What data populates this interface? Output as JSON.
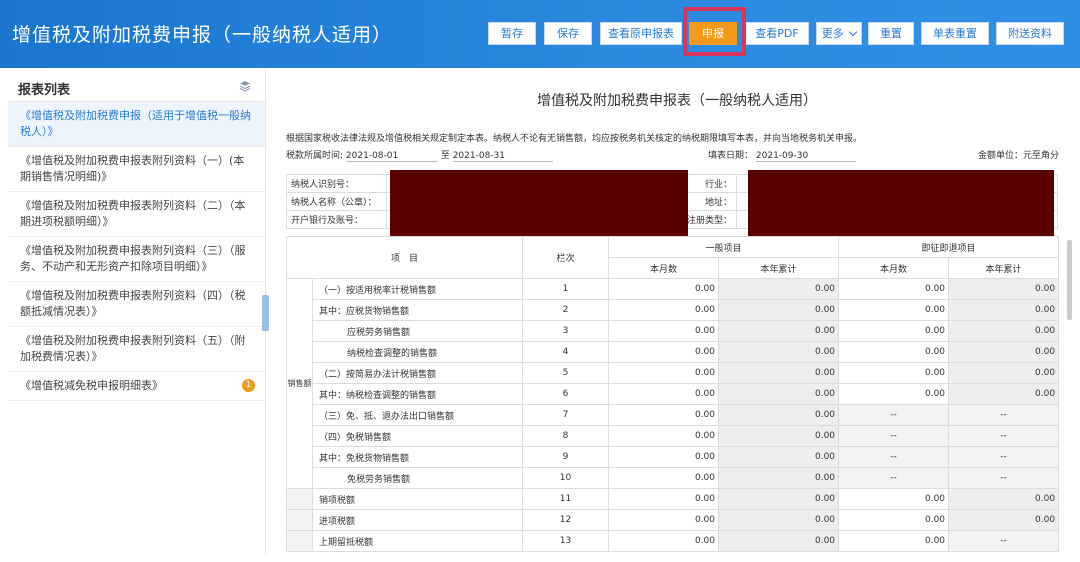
{
  "header": {
    "title": "增值税及附加税费申报（一般纳税人适用）",
    "toolbar": [
      "暂存",
      "保存",
      "查看原申报表",
      "申报",
      "查看PDF",
      "更多",
      "重置",
      "单表重置",
      "附送资料"
    ]
  },
  "sidebar": {
    "title": "报表列表",
    "items": [
      {
        "label": "《增值税及附加税费申报（适用于增值税一般纳税人）》",
        "active": true
      },
      {
        "label": "《增值税及附加税费申报表附列资料（一）(本期销售情况明细)》"
      },
      {
        "label": "《增值税及附加税费申报表附列资料（二）（本期进项税额明细）》"
      },
      {
        "label": "《增值税及附加税费申报表附列资料（三）（服务、不动产和无形资产扣除项目明细）》"
      },
      {
        "label": "《增值税及附加税费申报表附列资料（四）（税额抵减情况表）》"
      },
      {
        "label": "《增值税及附加税费申报表附列资料（五）（附加税费情况表）》"
      },
      {
        "label": "《增值税减免税申报明细表》",
        "badge": "1"
      }
    ]
  },
  "doc": {
    "title": "增值税及附加税费申报表（一般纳税人适用）",
    "notice": "根据国家税收法律法规及增值税相关规定制定本表。纳税人不论有无销售额，均应按税务机关核定的纳税期限填写本表，并向当地税务机关申报。",
    "period_label": "税款所属时间:",
    "period_from": "2021-08-01",
    "period_to_label": "至",
    "period_to": "2021-08-31",
    "fill_date_label": "填表日期：",
    "fill_date": "2021-09-30",
    "unit": "金额单位：元至角分",
    "taxpayer_id_label": "纳税人识别号：",
    "taxpayer_name_label": "纳税人名称（公章）：",
    "bank_label": "开户银行及账号：",
    "industry_label": "行业：",
    "address_label": "地址：",
    "reg_type_label": "注册类型：",
    "col_item": "项　目",
    "col_lineno": "栏次",
    "group_general": "一般项目",
    "group_refund": "即征即退项目",
    "sub_month": "本月数",
    "sub_year": "本年累计",
    "cat_sales": "销售额",
    "rows": [
      {
        "item": "（一）按适用税率计税销售额",
        "no": "1",
        "a": "0.00",
        "b": "0.00",
        "c": "0.00",
        "d": "0.00"
      },
      {
        "item": "其中：应税货物销售额",
        "no": "2",
        "a": "0.00",
        "b": "0.00",
        "c": "0.00",
        "d": "0.00"
      },
      {
        "item": "应税劳务销售额",
        "no": "3",
        "a": "0.00",
        "b": "0.00",
        "c": "0.00",
        "d": "0.00",
        "indent": true
      },
      {
        "item": "纳税检查调整的销售额",
        "no": "4",
        "a": "0.00",
        "b": "0.00",
        "c": "0.00",
        "d": "0.00",
        "indent": true
      },
      {
        "item": "（二）按简易办法计税销售额",
        "no": "5",
        "a": "0.00",
        "b": "0.00",
        "c": "0.00",
        "d": "0.00"
      },
      {
        "item": "其中：纳税检查调整的销售额",
        "no": "6",
        "a": "0.00",
        "b": "0.00",
        "c": "0.00",
        "d": "0.00"
      },
      {
        "item": "（三）免、抵、退办法出口销售额",
        "no": "7",
        "a": "0.00",
        "b": "0.00",
        "c": "--",
        "d": "--"
      },
      {
        "item": "（四）免税销售额",
        "no": "8",
        "a": "0.00",
        "b": "0.00",
        "c": "--",
        "d": "--"
      },
      {
        "item": "其中：免税货物销售额",
        "no": "9",
        "a": "0.00",
        "b": "0.00",
        "c": "--",
        "d": "--"
      },
      {
        "item": "免税劳务销售额",
        "no": "10",
        "a": "0.00",
        "b": "0.00",
        "c": "--",
        "d": "--",
        "indent": true
      },
      {
        "item": "销项税额",
        "no": "11",
        "a": "0.00",
        "b": "0.00",
        "c": "0.00",
        "d": "0.00"
      },
      {
        "item": "进项税额",
        "no": "12",
        "a": "0.00",
        "b": "0.00",
        "c": "0.00",
        "d": "0.00"
      },
      {
        "item": "上期留抵税额",
        "no": "13",
        "a": "0.00",
        "b": "0.00",
        "c": "0.00",
        "d": "--"
      }
    ]
  },
  "colors": {
    "header": "#1b75cf",
    "primary_button": "#f39a1a",
    "highlight": "#d9355a",
    "redaction": "#5a0000"
  }
}
